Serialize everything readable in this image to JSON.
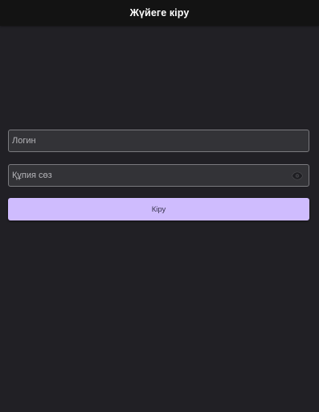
{
  "app_bar": {
    "title": "Жүйеге кіру"
  },
  "login_form": {
    "username_field": {
      "value": "",
      "placeholder": "Логин"
    },
    "password_field": {
      "value": "",
      "placeholder": "Құпия сөз",
      "visibility_icon": "eye-icon"
    },
    "submit_label": "Кіру"
  },
  "colors": {
    "background": "#212025",
    "app_bar": "#131313",
    "field_fill": "#333337",
    "field_border": "#7a7a7e",
    "button_accent": "#cfbcfe"
  }
}
